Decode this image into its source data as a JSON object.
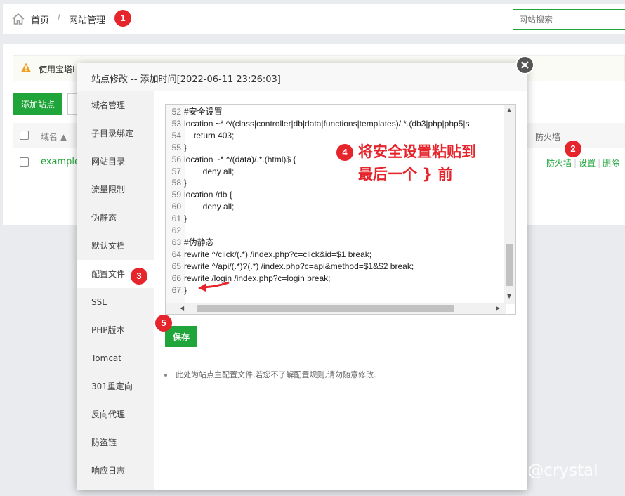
{
  "breadcrumb": {
    "home": "首页",
    "separator": "/",
    "current": "网站管理"
  },
  "search": {
    "placeholder": "网站搜索"
  },
  "notice": {
    "text": "使用宝塔L"
  },
  "toolbar": {
    "add_site": "添加站点"
  },
  "table": {
    "headers": {
      "domain": "域名 ▲",
      "firewall": "防火墙"
    },
    "rows": [
      {
        "domain": "example.",
        "ops": [
          "防火墙",
          "设置",
          "删除"
        ]
      }
    ]
  },
  "modal": {
    "title": "站点修改 -- 添加时间[2022-06-11 23:26:03]",
    "nav": [
      "域名管理",
      "子目录绑定",
      "网站目录",
      "流量限制",
      "伪静态",
      "默认文档",
      "配置文件",
      "SSL",
      "PHP版本",
      "Tomcat",
      "301重定向",
      "反向代理",
      "防盗链",
      "响应日志"
    ],
    "active_nav_index": 6,
    "code_lines": [
      {
        "n": "52",
        "t": "#安全设置"
      },
      {
        "n": "53",
        "t": "location ~* ^/(class|controller|db|data|functions|templates)/.*.(db3|php|php5|s"
      },
      {
        "n": "54",
        "t": "    return 403;"
      },
      {
        "n": "55",
        "t": "}"
      },
      {
        "n": "56",
        "t": "location ~* ^/(data)/.*.(html)$ {"
      },
      {
        "n": "57",
        "t": "        deny all;"
      },
      {
        "n": "58",
        "t": "}"
      },
      {
        "n": "59",
        "t": "location /db {"
      },
      {
        "n": "60",
        "t": "        deny all;"
      },
      {
        "n": "61",
        "t": "}"
      },
      {
        "n": "62",
        "t": ""
      },
      {
        "n": "63",
        "t": "#伪静态"
      },
      {
        "n": "64",
        "t": "rewrite ^/click/(.*) /index.php?c=click&id=$1 break;"
      },
      {
        "n": "65",
        "t": "rewrite ^/api/(.*)?(.*) /index.php?c=api&method=$1&$2 break;"
      },
      {
        "n": "66",
        "t": "rewrite /login /index.php?c=login break;"
      },
      {
        "n": "67",
        "t": "}"
      }
    ],
    "save_label": "保存",
    "note": "此处为站点主配置文件,若您不了解配置规则,请勿随意修改."
  },
  "annotation": {
    "line1": "将安全设置粘贴到",
    "line2": "最后一个 } 前"
  },
  "badges": [
    "1",
    "2",
    "3",
    "4",
    "5"
  ],
  "watermark": "知乎 @crystal",
  "colors": {
    "accent": "#20a53a",
    "badge": "#e5242b",
    "close": "#555555"
  }
}
